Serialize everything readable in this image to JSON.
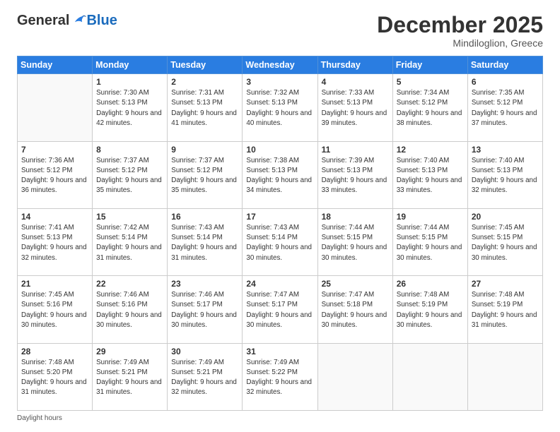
{
  "header": {
    "logo_general": "General",
    "logo_blue": "Blue",
    "month_title": "December 2025",
    "location": "Mindiloglion, Greece"
  },
  "days_of_week": [
    "Sunday",
    "Monday",
    "Tuesday",
    "Wednesday",
    "Thursday",
    "Friday",
    "Saturday"
  ],
  "footer": {
    "daylight_label": "Daylight hours"
  },
  "weeks": [
    [
      {
        "day": "",
        "sunrise": "",
        "sunset": "",
        "daylight": ""
      },
      {
        "day": "1",
        "sunrise": "Sunrise: 7:30 AM",
        "sunset": "Sunset: 5:13 PM",
        "daylight": "Daylight: 9 hours and 42 minutes."
      },
      {
        "day": "2",
        "sunrise": "Sunrise: 7:31 AM",
        "sunset": "Sunset: 5:13 PM",
        "daylight": "Daylight: 9 hours and 41 minutes."
      },
      {
        "day": "3",
        "sunrise": "Sunrise: 7:32 AM",
        "sunset": "Sunset: 5:13 PM",
        "daylight": "Daylight: 9 hours and 40 minutes."
      },
      {
        "day": "4",
        "sunrise": "Sunrise: 7:33 AM",
        "sunset": "Sunset: 5:13 PM",
        "daylight": "Daylight: 9 hours and 39 minutes."
      },
      {
        "day": "5",
        "sunrise": "Sunrise: 7:34 AM",
        "sunset": "Sunset: 5:12 PM",
        "daylight": "Daylight: 9 hours and 38 minutes."
      },
      {
        "day": "6",
        "sunrise": "Sunrise: 7:35 AM",
        "sunset": "Sunset: 5:12 PM",
        "daylight": "Daylight: 9 hours and 37 minutes."
      }
    ],
    [
      {
        "day": "7",
        "sunrise": "Sunrise: 7:36 AM",
        "sunset": "Sunset: 5:12 PM",
        "daylight": "Daylight: 9 hours and 36 minutes."
      },
      {
        "day": "8",
        "sunrise": "Sunrise: 7:37 AM",
        "sunset": "Sunset: 5:12 PM",
        "daylight": "Daylight: 9 hours and 35 minutes."
      },
      {
        "day": "9",
        "sunrise": "Sunrise: 7:37 AM",
        "sunset": "Sunset: 5:12 PM",
        "daylight": "Daylight: 9 hours and 35 minutes."
      },
      {
        "day": "10",
        "sunrise": "Sunrise: 7:38 AM",
        "sunset": "Sunset: 5:13 PM",
        "daylight": "Daylight: 9 hours and 34 minutes."
      },
      {
        "day": "11",
        "sunrise": "Sunrise: 7:39 AM",
        "sunset": "Sunset: 5:13 PM",
        "daylight": "Daylight: 9 hours and 33 minutes."
      },
      {
        "day": "12",
        "sunrise": "Sunrise: 7:40 AM",
        "sunset": "Sunset: 5:13 PM",
        "daylight": "Daylight: 9 hours and 33 minutes."
      },
      {
        "day": "13",
        "sunrise": "Sunrise: 7:40 AM",
        "sunset": "Sunset: 5:13 PM",
        "daylight": "Daylight: 9 hours and 32 minutes."
      }
    ],
    [
      {
        "day": "14",
        "sunrise": "Sunrise: 7:41 AM",
        "sunset": "Sunset: 5:13 PM",
        "daylight": "Daylight: 9 hours and 32 minutes."
      },
      {
        "day": "15",
        "sunrise": "Sunrise: 7:42 AM",
        "sunset": "Sunset: 5:14 PM",
        "daylight": "Daylight: 9 hours and 31 minutes."
      },
      {
        "day": "16",
        "sunrise": "Sunrise: 7:43 AM",
        "sunset": "Sunset: 5:14 PM",
        "daylight": "Daylight: 9 hours and 31 minutes."
      },
      {
        "day": "17",
        "sunrise": "Sunrise: 7:43 AM",
        "sunset": "Sunset: 5:14 PM",
        "daylight": "Daylight: 9 hours and 30 minutes."
      },
      {
        "day": "18",
        "sunrise": "Sunrise: 7:44 AM",
        "sunset": "Sunset: 5:15 PM",
        "daylight": "Daylight: 9 hours and 30 minutes."
      },
      {
        "day": "19",
        "sunrise": "Sunrise: 7:44 AM",
        "sunset": "Sunset: 5:15 PM",
        "daylight": "Daylight: 9 hours and 30 minutes."
      },
      {
        "day": "20",
        "sunrise": "Sunrise: 7:45 AM",
        "sunset": "Sunset: 5:15 PM",
        "daylight": "Daylight: 9 hours and 30 minutes."
      }
    ],
    [
      {
        "day": "21",
        "sunrise": "Sunrise: 7:45 AM",
        "sunset": "Sunset: 5:16 PM",
        "daylight": "Daylight: 9 hours and 30 minutes."
      },
      {
        "day": "22",
        "sunrise": "Sunrise: 7:46 AM",
        "sunset": "Sunset: 5:16 PM",
        "daylight": "Daylight: 9 hours and 30 minutes."
      },
      {
        "day": "23",
        "sunrise": "Sunrise: 7:46 AM",
        "sunset": "Sunset: 5:17 PM",
        "daylight": "Daylight: 9 hours and 30 minutes."
      },
      {
        "day": "24",
        "sunrise": "Sunrise: 7:47 AM",
        "sunset": "Sunset: 5:17 PM",
        "daylight": "Daylight: 9 hours and 30 minutes."
      },
      {
        "day": "25",
        "sunrise": "Sunrise: 7:47 AM",
        "sunset": "Sunset: 5:18 PM",
        "daylight": "Daylight: 9 hours and 30 minutes."
      },
      {
        "day": "26",
        "sunrise": "Sunrise: 7:48 AM",
        "sunset": "Sunset: 5:19 PM",
        "daylight": "Daylight: 9 hours and 30 minutes."
      },
      {
        "day": "27",
        "sunrise": "Sunrise: 7:48 AM",
        "sunset": "Sunset: 5:19 PM",
        "daylight": "Daylight: 9 hours and 31 minutes."
      }
    ],
    [
      {
        "day": "28",
        "sunrise": "Sunrise: 7:48 AM",
        "sunset": "Sunset: 5:20 PM",
        "daylight": "Daylight: 9 hours and 31 minutes."
      },
      {
        "day": "29",
        "sunrise": "Sunrise: 7:49 AM",
        "sunset": "Sunset: 5:21 PM",
        "daylight": "Daylight: 9 hours and 31 minutes."
      },
      {
        "day": "30",
        "sunrise": "Sunrise: 7:49 AM",
        "sunset": "Sunset: 5:21 PM",
        "daylight": "Daylight: 9 hours and 32 minutes."
      },
      {
        "day": "31",
        "sunrise": "Sunrise: 7:49 AM",
        "sunset": "Sunset: 5:22 PM",
        "daylight": "Daylight: 9 hours and 32 minutes."
      },
      {
        "day": "",
        "sunrise": "",
        "sunset": "",
        "daylight": ""
      },
      {
        "day": "",
        "sunrise": "",
        "sunset": "",
        "daylight": ""
      },
      {
        "day": "",
        "sunrise": "",
        "sunset": "",
        "daylight": ""
      }
    ]
  ]
}
